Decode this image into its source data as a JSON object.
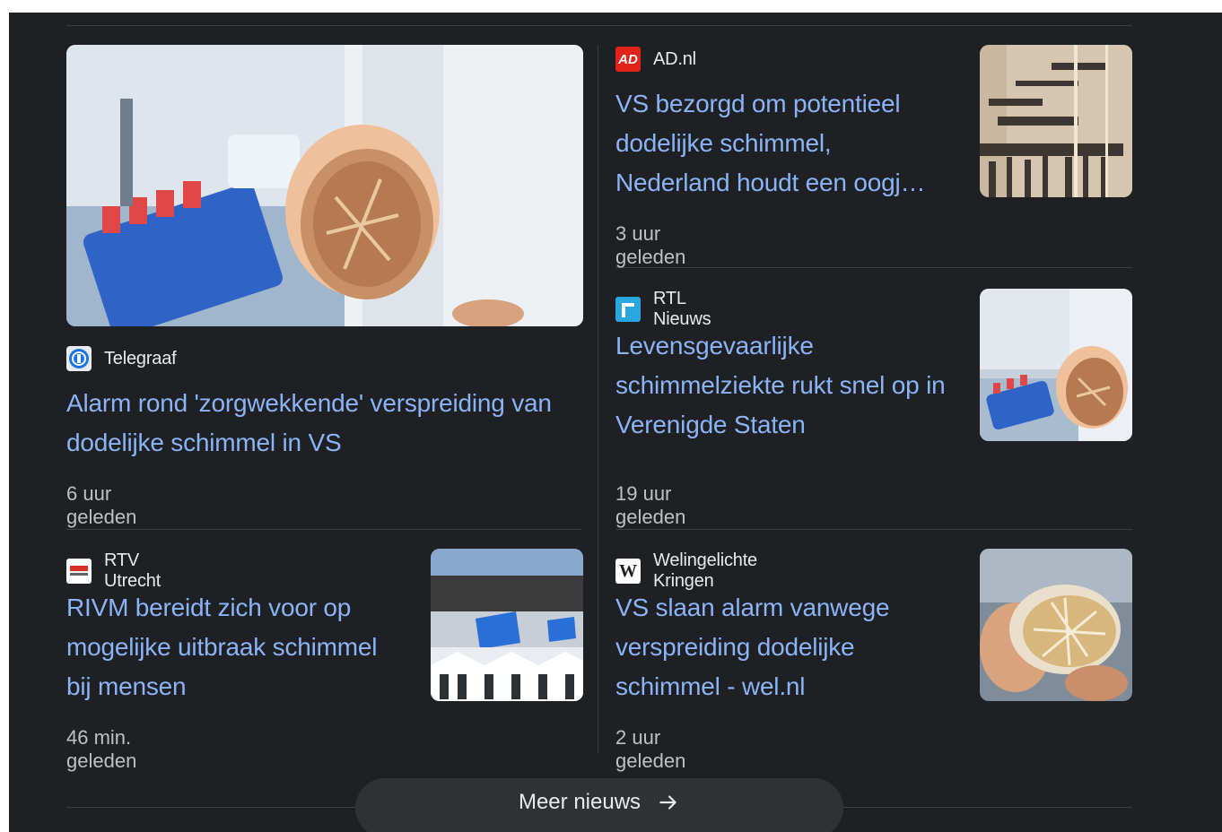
{
  "articles": [
    {
      "source": "Telegraaf",
      "title": "Alarm rond 'zorgwekkende' verspreiding van dodelijke schimmel in VS",
      "time": "6 uur geleden"
    },
    {
      "source": "AD.nl",
      "title": "VS bezorgd om potentieel dodelijke schimmel, Nederland houdt een oogj…",
      "time": "3 uur geleden"
    },
    {
      "source": "RTL Nieuws",
      "title": "Levensgevaarlijke schimmelziekte rukt snel op in Verenigde Staten",
      "time": "19 uur geleden"
    },
    {
      "source": "RTV Utrecht",
      "title": "RIVM bereidt zich voor op mogelijke uitbraak schimmel bij mensen",
      "time": "46 min. geleden"
    },
    {
      "source": "Welingelichte Kringen",
      "title": "VS slaan alarm vanwege verspreiding dodelijke schimmel - wel.nl",
      "time": "2 uur geleden"
    }
  ],
  "icons": {
    "telegraaf": "telegraaf-logo-icon",
    "ad": "ad-logo-icon",
    "rtl": "rtl-logo-icon",
    "rtv": "rtv-utrecht-logo-icon",
    "wel": "welingelichte-kringen-logo-icon",
    "arrow": "arrow-right-icon"
  },
  "more_button": {
    "label": "Meer nieuws"
  },
  "colors": {
    "background": "#1f2023",
    "link": "#8ab4f8",
    "text": "#e8eaed",
    "muted": "#bdc1c6",
    "divider": "#3c4043"
  }
}
